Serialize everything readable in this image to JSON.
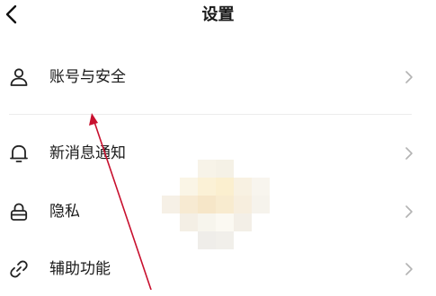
{
  "header": {
    "title": "设置"
  },
  "rows": [
    {
      "label": "账号与安全",
      "icon": "user-icon"
    },
    {
      "label": "新消息通知",
      "icon": "bell-icon"
    },
    {
      "label": "隐私",
      "icon": "lock-icon"
    },
    {
      "label": "辅助功能",
      "icon": "link-icon"
    }
  ],
  "colors": {
    "annotation_arrow": "#c8102e",
    "divider": "#ececec",
    "chevron": "#b3b3b3"
  }
}
